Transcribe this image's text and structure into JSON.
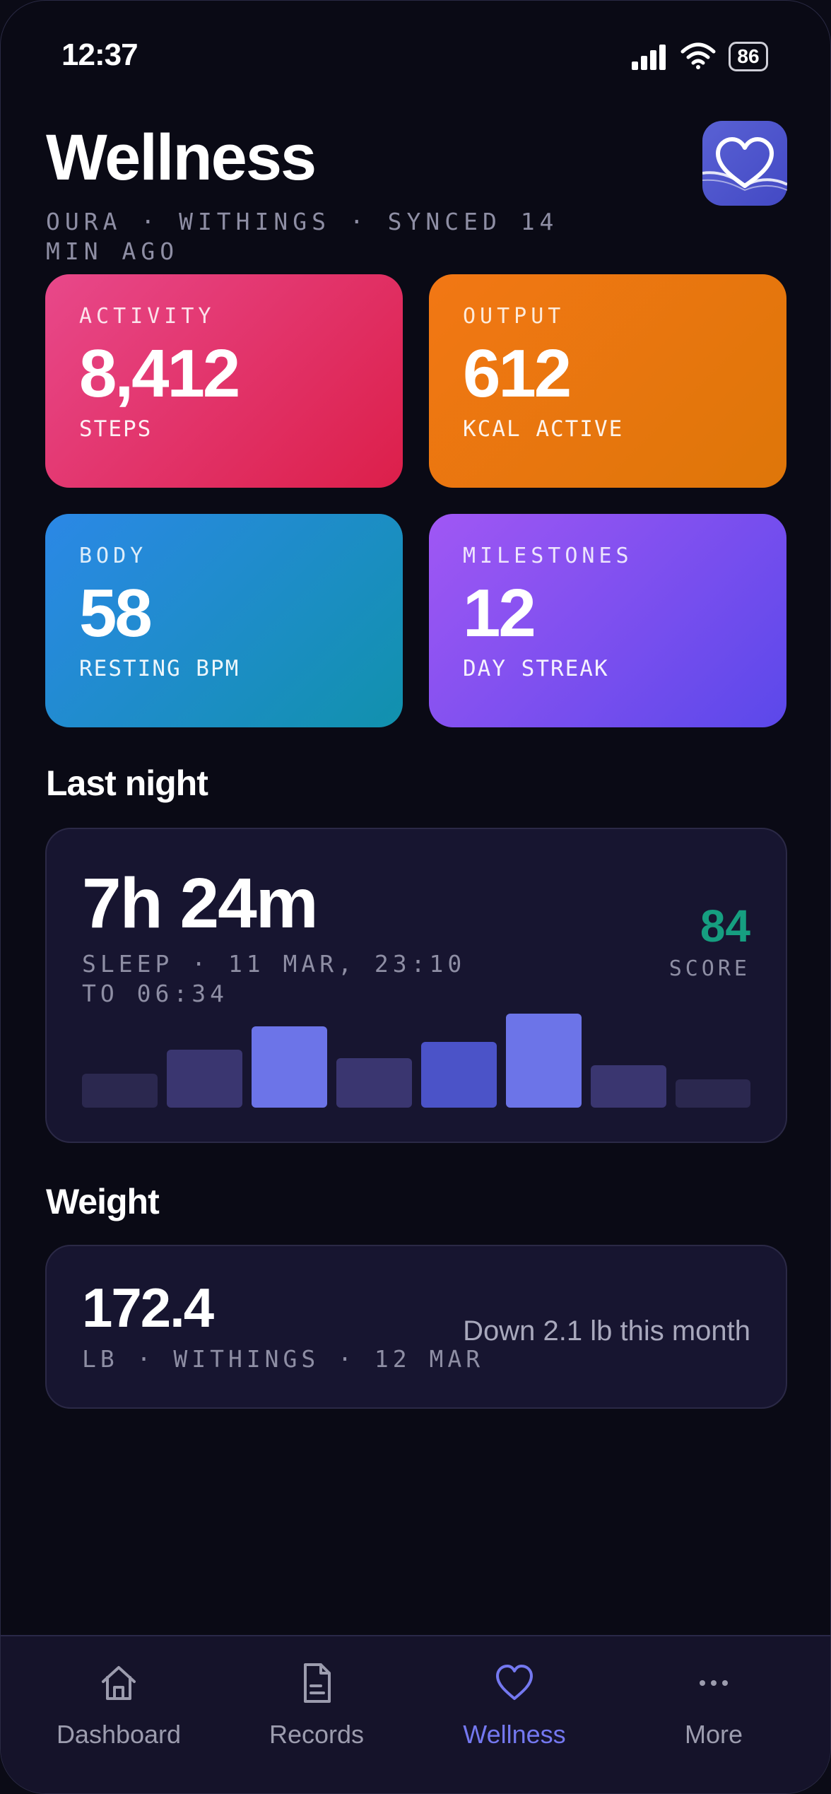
{
  "status_bar": {
    "time": "12:37",
    "battery": "86"
  },
  "header": {
    "title": "Wellness",
    "subtitle": "OURA · WITHINGS · SYNCED 14 MIN AGO"
  },
  "tiles": [
    {
      "label": "ACTIVITY",
      "value": "8,412",
      "unit": "STEPS"
    },
    {
      "label": "OUTPUT",
      "value": "612",
      "unit": "KCAL ACTIVE"
    },
    {
      "label": "BODY",
      "value": "58",
      "unit": "RESTING BPM"
    },
    {
      "label": "MILESTONES",
      "value": "12",
      "unit": "DAY STREAK"
    }
  ],
  "sleep": {
    "section_title": "Last night",
    "duration": "7h 24m",
    "detail": "SLEEP · 11 MAR, 23:10 TO 06:34",
    "score": "84",
    "score_label": "SCORE"
  },
  "weight": {
    "section_title": "Weight",
    "value": "172.4",
    "detail": "LB · WITHINGS · 12 MAR",
    "trend": "Down 2.1 lb this month"
  },
  "tabbar": {
    "items": [
      {
        "label": "Dashboard",
        "icon": "home-icon"
      },
      {
        "label": "Records",
        "icon": "document-icon"
      },
      {
        "label": "Wellness",
        "icon": "heart-icon",
        "active": true
      },
      {
        "label": "More",
        "icon": "more-icon"
      }
    ]
  },
  "colors": {
    "accent": "#7478f0",
    "score": "#169e80",
    "background": "#0a0a15"
  }
}
